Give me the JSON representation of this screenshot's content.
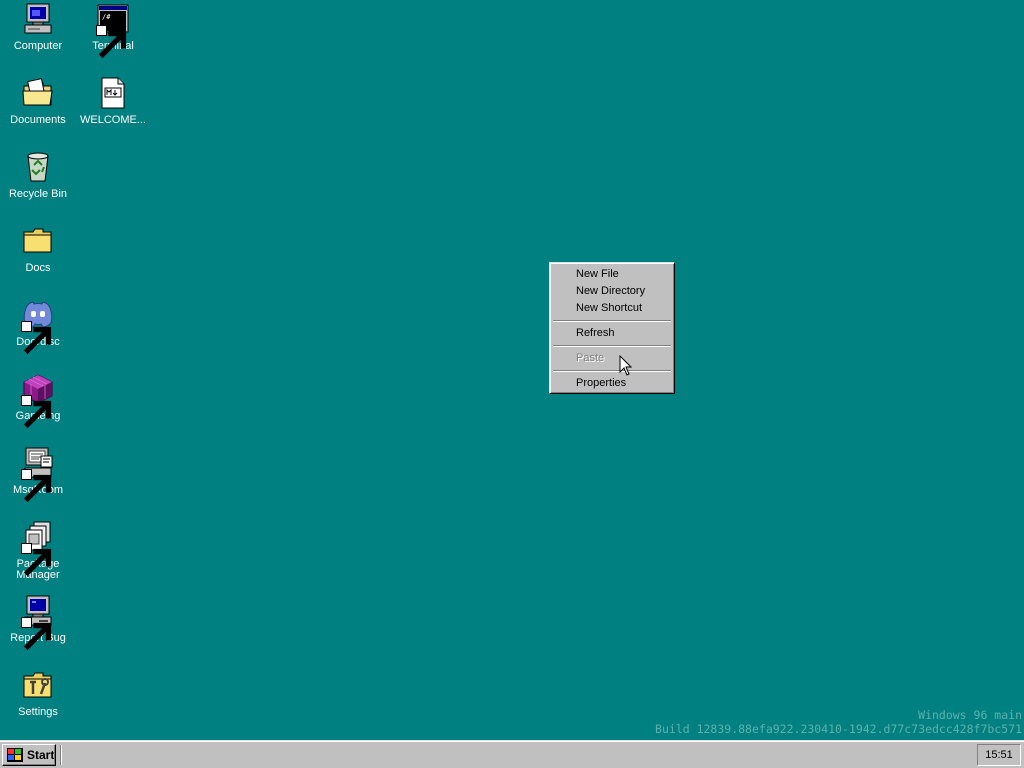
{
  "desktop_icons": [
    {
      "label": "Computer",
      "icon": "computer-icon",
      "shortcut": false
    },
    {
      "label": "Terminal",
      "icon": "terminal-icon",
      "shortcut": true
    },
    {
      "label": "Documents",
      "icon": "documents-folder-icon",
      "shortcut": false
    },
    {
      "label": "WELCOME...",
      "icon": "markdown-file-icon",
      "shortcut": false
    },
    {
      "label": "Recycle Bin",
      "icon": "recycle-bin-icon",
      "shortcut": false
    },
    {
      "label": "Docs",
      "icon": "folder-icon",
      "shortcut": false
    },
    {
      "label": "Doordisc",
      "icon": "discord-icon",
      "shortcut": true
    },
    {
      "label": "Gameing",
      "icon": "game-cube-icon",
      "shortcut": true
    },
    {
      "label": "MsgRoom",
      "icon": "chat-computer-icon",
      "shortcut": true
    },
    {
      "label": "Package Manager",
      "icon": "package-manager-icon",
      "shortcut": true
    },
    {
      "label": "Report Bug",
      "icon": "report-bug-computer-icon",
      "shortcut": true
    },
    {
      "label": "Settings",
      "icon": "settings-tools-icon",
      "shortcut": false
    }
  ],
  "context_menu": {
    "items": [
      {
        "label": "New File",
        "disabled": false
      },
      {
        "label": "New Directory",
        "disabled": false
      },
      {
        "label": "New Shortcut",
        "disabled": false
      },
      {
        "label": "Refresh",
        "disabled": false
      },
      {
        "label": "Paste",
        "disabled": true
      },
      {
        "label": "Properties",
        "disabled": false
      }
    ]
  },
  "watermark": {
    "line1": "Windows 96 main",
    "line2": "Build 12839.88efa922.230410-1942.d77c73edcc428f7bc571"
  },
  "taskbar": {
    "start_label": "Start",
    "clock": "15:51"
  },
  "colors": {
    "desktop": "#008080",
    "chrome": "#c0c0c0",
    "disabled_text": "#808080"
  }
}
